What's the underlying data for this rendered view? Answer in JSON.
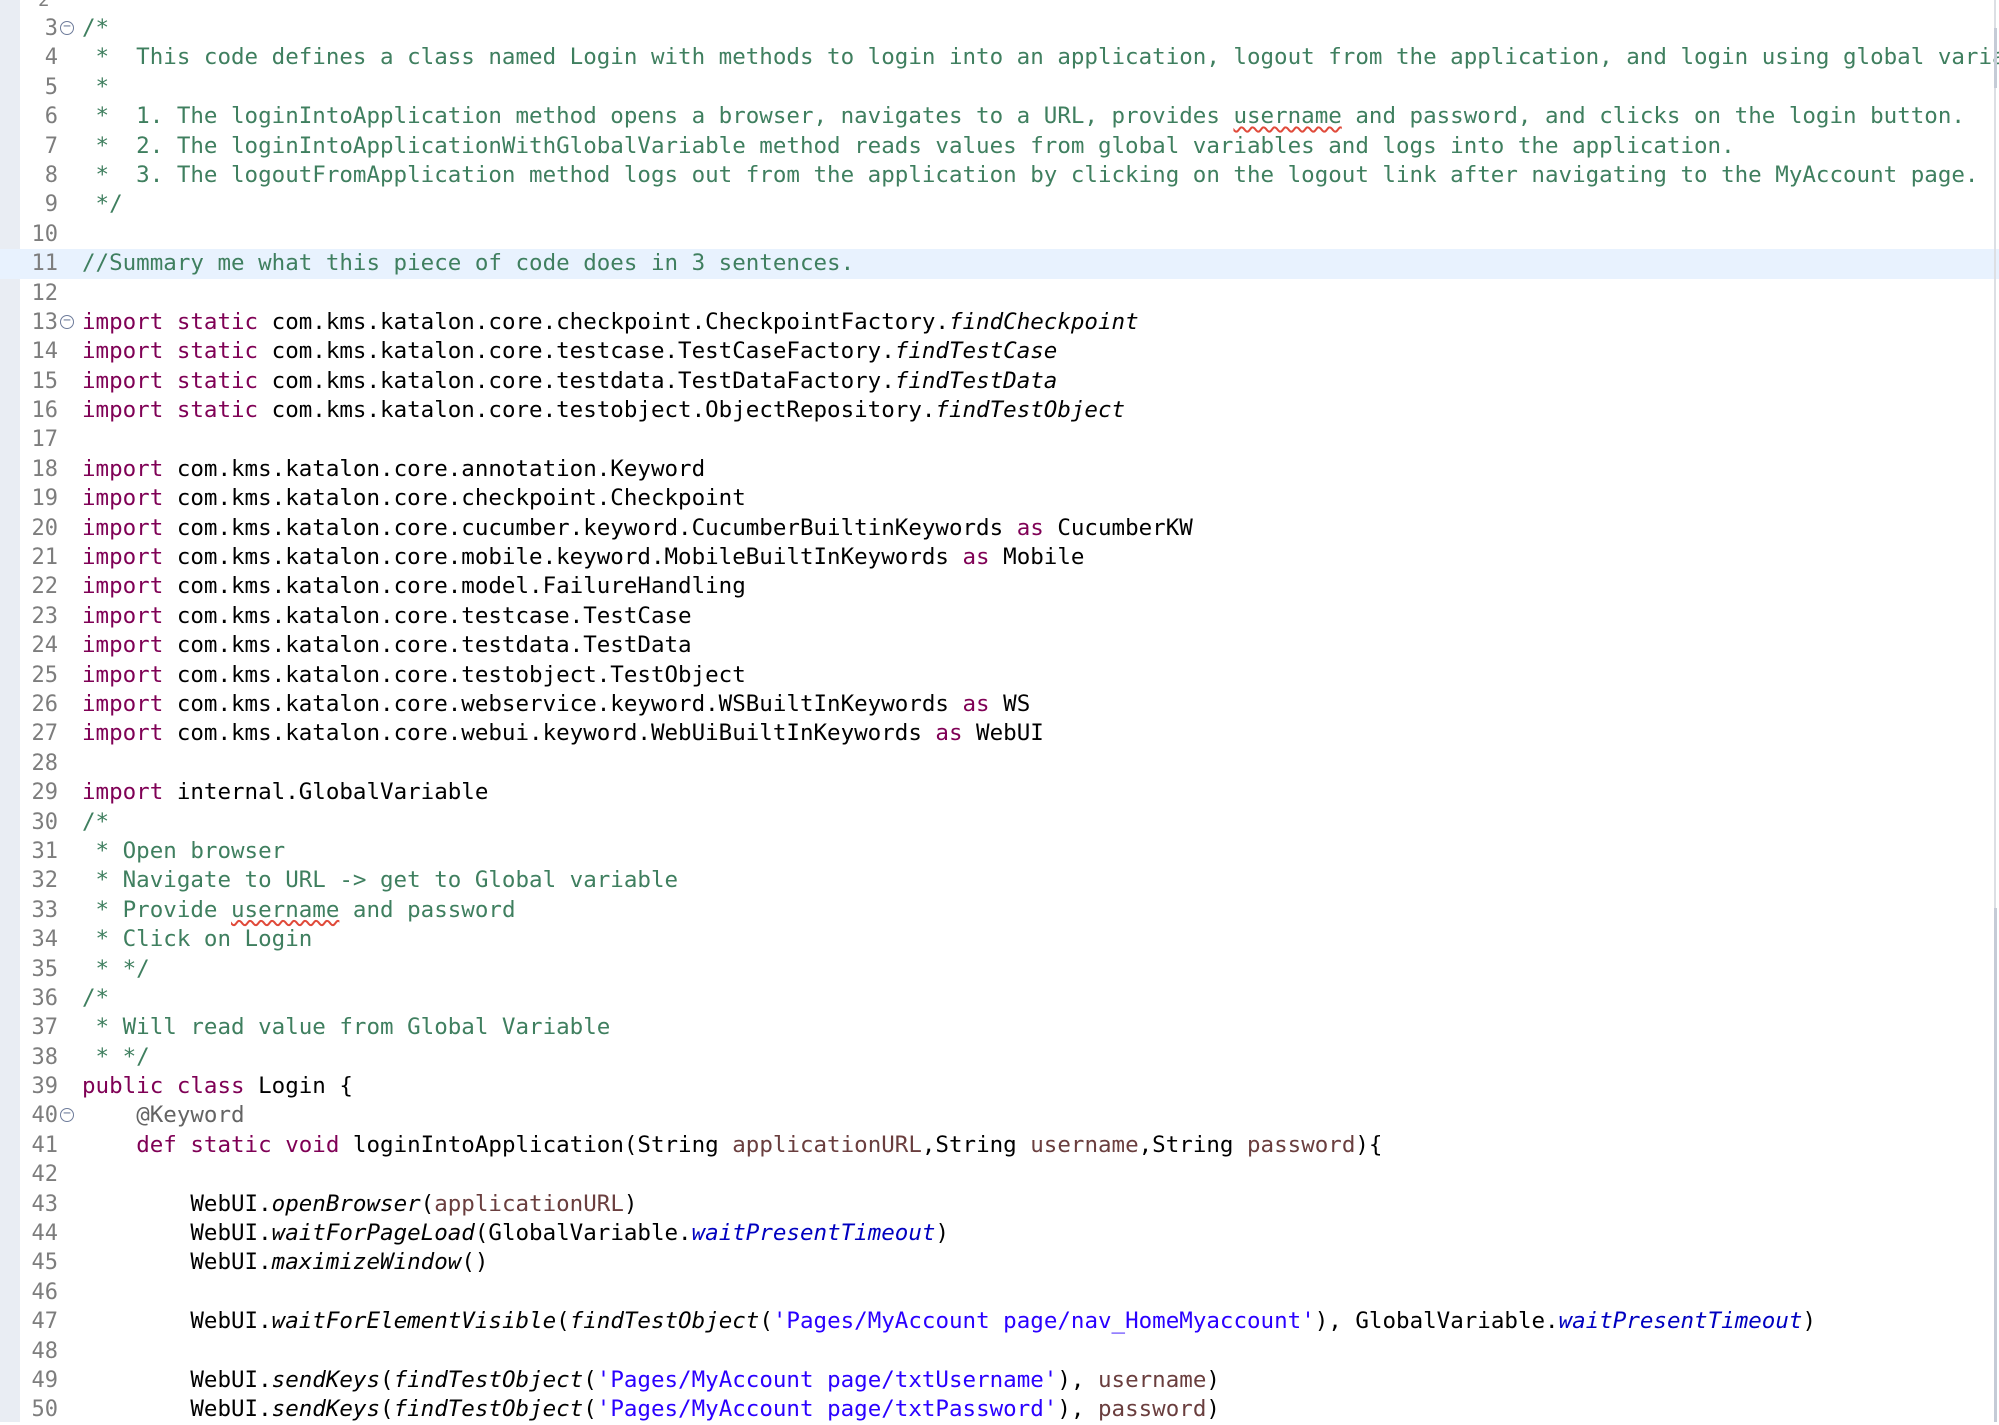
{
  "editor": {
    "top_line_number": "2",
    "lines": [
      {
        "n": "3",
        "fold": true,
        "highlight": false,
        "segs": [
          {
            "t": "/*",
            "c": "comment"
          }
        ]
      },
      {
        "n": "4",
        "fold": false,
        "highlight": false,
        "segs": [
          {
            "t": " *  This code defines a class named Login with methods to login into an application, logout from the application, and login using global variables.",
            "c": "comment"
          }
        ]
      },
      {
        "n": "5",
        "fold": false,
        "highlight": false,
        "segs": [
          {
            "t": " *",
            "c": "comment"
          }
        ]
      },
      {
        "n": "6",
        "fold": false,
        "highlight": false,
        "segs": [
          {
            "t": " *  1. The loginIntoApplication method opens a browser, navigates to a URL, provides ",
            "c": "comment"
          },
          {
            "t": "username",
            "c": "comment",
            "spell": true
          },
          {
            "t": " and password, and clicks on the login button.",
            "c": "comment"
          }
        ]
      },
      {
        "n": "7",
        "fold": false,
        "highlight": false,
        "segs": [
          {
            "t": " *  2. The loginIntoApplicationWithGlobalVariable method reads values from global variables and logs into the application.",
            "c": "comment"
          }
        ]
      },
      {
        "n": "8",
        "fold": false,
        "highlight": false,
        "segs": [
          {
            "t": " *  3. The logoutFromApplication method logs out from the application by clicking on the logout link after navigating to the MyAccount page.",
            "c": "comment"
          }
        ]
      },
      {
        "n": "9",
        "fold": false,
        "highlight": false,
        "segs": [
          {
            "t": " */",
            "c": "comment"
          }
        ]
      },
      {
        "n": "10",
        "fold": false,
        "highlight": false,
        "segs": []
      },
      {
        "n": "11",
        "fold": false,
        "highlight": true,
        "segs": [
          {
            "t": "//Summary me what this piece of code does in 3 sentences.",
            "c": "comment"
          }
        ]
      },
      {
        "n": "12",
        "fold": false,
        "highlight": false,
        "segs": []
      },
      {
        "n": "13",
        "fold": true,
        "highlight": false,
        "segs": [
          {
            "t": "import static",
            "c": "keyword"
          },
          {
            "t": " com.kms.katalon.core.checkpoint.CheckpointFactory.",
            "c": "plain"
          },
          {
            "t": "findCheckpoint",
            "c": "method"
          }
        ]
      },
      {
        "n": "14",
        "fold": false,
        "highlight": false,
        "segs": [
          {
            "t": "import static",
            "c": "keyword"
          },
          {
            "t": " com.kms.katalon.core.testcase.TestCaseFactory.",
            "c": "plain"
          },
          {
            "t": "findTestCase",
            "c": "method"
          }
        ]
      },
      {
        "n": "15",
        "fold": false,
        "highlight": false,
        "segs": [
          {
            "t": "import static",
            "c": "keyword"
          },
          {
            "t": " com.kms.katalon.core.testdata.TestDataFactory.",
            "c": "plain"
          },
          {
            "t": "findTestData",
            "c": "method"
          }
        ]
      },
      {
        "n": "16",
        "fold": false,
        "highlight": false,
        "segs": [
          {
            "t": "import static",
            "c": "keyword"
          },
          {
            "t": " com.kms.katalon.core.testobject.ObjectRepository.",
            "c": "plain"
          },
          {
            "t": "findTestObject",
            "c": "method"
          }
        ]
      },
      {
        "n": "17",
        "fold": false,
        "highlight": false,
        "segs": []
      },
      {
        "n": "18",
        "fold": false,
        "highlight": false,
        "segs": [
          {
            "t": "import",
            "c": "keyword"
          },
          {
            "t": " com.kms.katalon.core.annotation.Keyword",
            "c": "plain"
          }
        ]
      },
      {
        "n": "19",
        "fold": false,
        "highlight": false,
        "segs": [
          {
            "t": "import",
            "c": "keyword"
          },
          {
            "t": " com.kms.katalon.core.checkpoint.Checkpoint",
            "c": "plain"
          }
        ]
      },
      {
        "n": "20",
        "fold": false,
        "highlight": false,
        "segs": [
          {
            "t": "import",
            "c": "keyword"
          },
          {
            "t": " com.kms.katalon.core.cucumber.keyword.CucumberBuiltinKeywords ",
            "c": "plain"
          },
          {
            "t": "as",
            "c": "keyword"
          },
          {
            "t": " CucumberKW",
            "c": "plain"
          }
        ]
      },
      {
        "n": "21",
        "fold": false,
        "highlight": false,
        "segs": [
          {
            "t": "import",
            "c": "keyword"
          },
          {
            "t": " com.kms.katalon.core.mobile.keyword.MobileBuiltInKeywords ",
            "c": "plain"
          },
          {
            "t": "as",
            "c": "keyword"
          },
          {
            "t": " Mobile",
            "c": "plain"
          }
        ]
      },
      {
        "n": "22",
        "fold": false,
        "highlight": false,
        "segs": [
          {
            "t": "import",
            "c": "keyword"
          },
          {
            "t": " com.kms.katalon.core.model.FailureHandling",
            "c": "plain"
          }
        ]
      },
      {
        "n": "23",
        "fold": false,
        "highlight": false,
        "segs": [
          {
            "t": "import",
            "c": "keyword"
          },
          {
            "t": " com.kms.katalon.core.testcase.TestCase",
            "c": "plain"
          }
        ]
      },
      {
        "n": "24",
        "fold": false,
        "highlight": false,
        "segs": [
          {
            "t": "import",
            "c": "keyword"
          },
          {
            "t": " com.kms.katalon.core.testdata.TestData",
            "c": "plain"
          }
        ]
      },
      {
        "n": "25",
        "fold": false,
        "highlight": false,
        "segs": [
          {
            "t": "import",
            "c": "keyword"
          },
          {
            "t": " com.kms.katalon.core.testobject.TestObject",
            "c": "plain"
          }
        ]
      },
      {
        "n": "26",
        "fold": false,
        "highlight": false,
        "segs": [
          {
            "t": "import",
            "c": "keyword"
          },
          {
            "t": " com.kms.katalon.core.webservice.keyword.WSBuiltInKeywords ",
            "c": "plain"
          },
          {
            "t": "as",
            "c": "keyword"
          },
          {
            "t": " WS",
            "c": "plain"
          }
        ]
      },
      {
        "n": "27",
        "fold": false,
        "highlight": false,
        "segs": [
          {
            "t": "import",
            "c": "keyword"
          },
          {
            "t": " com.kms.katalon.core.webui.keyword.WebUiBuiltInKeywords ",
            "c": "plain"
          },
          {
            "t": "as",
            "c": "keyword"
          },
          {
            "t": " WebUI",
            "c": "plain"
          }
        ]
      },
      {
        "n": "28",
        "fold": false,
        "highlight": false,
        "segs": []
      },
      {
        "n": "29",
        "fold": false,
        "highlight": false,
        "segs": [
          {
            "t": "import",
            "c": "keyword"
          },
          {
            "t": " internal.GlobalVariable",
            "c": "plain"
          }
        ]
      },
      {
        "n": "30",
        "fold": false,
        "highlight": false,
        "segs": [
          {
            "t": "/*",
            "c": "comment"
          }
        ]
      },
      {
        "n": "31",
        "fold": false,
        "highlight": false,
        "segs": [
          {
            "t": " * Open browser",
            "c": "comment"
          }
        ]
      },
      {
        "n": "32",
        "fold": false,
        "highlight": false,
        "segs": [
          {
            "t": " * Navigate to URL -> get to Global variable",
            "c": "comment"
          }
        ]
      },
      {
        "n": "33",
        "fold": false,
        "highlight": false,
        "segs": [
          {
            "t": " * Provide ",
            "c": "comment"
          },
          {
            "t": "username",
            "c": "comment",
            "spell": true
          },
          {
            "t": " and password",
            "c": "comment"
          }
        ]
      },
      {
        "n": "34",
        "fold": false,
        "highlight": false,
        "segs": [
          {
            "t": " * Click on Login",
            "c": "comment"
          }
        ]
      },
      {
        "n": "35",
        "fold": false,
        "highlight": false,
        "segs": [
          {
            "t": " * */",
            "c": "comment"
          }
        ]
      },
      {
        "n": "36",
        "fold": false,
        "highlight": false,
        "segs": [
          {
            "t": "/*",
            "c": "comment"
          }
        ]
      },
      {
        "n": "37",
        "fold": false,
        "highlight": false,
        "segs": [
          {
            "t": " * Will read value from Global Variable",
            "c": "comment"
          }
        ]
      },
      {
        "n": "38",
        "fold": false,
        "highlight": false,
        "segs": [
          {
            "t": " * */",
            "c": "comment"
          }
        ]
      },
      {
        "n": "39",
        "fold": false,
        "highlight": false,
        "segs": [
          {
            "t": "public class",
            "c": "keyword"
          },
          {
            "t": " Login {",
            "c": "plain"
          }
        ]
      },
      {
        "n": "40",
        "fold": true,
        "highlight": false,
        "segs": [
          {
            "t": "    ",
            "c": "plain"
          },
          {
            "t": "@Keyword",
            "c": "annotation"
          }
        ]
      },
      {
        "n": "41",
        "fold": false,
        "highlight": false,
        "segs": [
          {
            "t": "    ",
            "c": "plain"
          },
          {
            "t": "def static void",
            "c": "keyword"
          },
          {
            "t": " loginIntoApplication(String ",
            "c": "plain"
          },
          {
            "t": "applicationURL",
            "c": "param"
          },
          {
            "t": ",String ",
            "c": "plain"
          },
          {
            "t": "username",
            "c": "param"
          },
          {
            "t": ",String ",
            "c": "plain"
          },
          {
            "t": "password",
            "c": "param"
          },
          {
            "t": "){",
            "c": "plain"
          }
        ]
      },
      {
        "n": "42",
        "fold": false,
        "highlight": false,
        "segs": []
      },
      {
        "n": "43",
        "fold": false,
        "highlight": false,
        "segs": [
          {
            "t": "        WebUI.",
            "c": "plain"
          },
          {
            "t": "openBrowser",
            "c": "method"
          },
          {
            "t": "(",
            "c": "plain"
          },
          {
            "t": "applicationURL",
            "c": "param"
          },
          {
            "t": ")",
            "c": "plain"
          }
        ]
      },
      {
        "n": "44",
        "fold": false,
        "highlight": false,
        "segs": [
          {
            "t": "        WebUI.",
            "c": "plain"
          },
          {
            "t": "waitForPageLoad",
            "c": "method"
          },
          {
            "t": "(GlobalVariable.",
            "c": "plain"
          },
          {
            "t": "waitPresentTimeout",
            "c": "field"
          },
          {
            "t": ")",
            "c": "plain"
          }
        ]
      },
      {
        "n": "45",
        "fold": false,
        "highlight": false,
        "segs": [
          {
            "t": "        WebUI.",
            "c": "plain"
          },
          {
            "t": "maximizeWindow",
            "c": "method"
          },
          {
            "t": "()",
            "c": "plain"
          }
        ]
      },
      {
        "n": "46",
        "fold": false,
        "highlight": false,
        "segs": []
      },
      {
        "n": "47",
        "fold": false,
        "highlight": false,
        "segs": [
          {
            "t": "        WebUI.",
            "c": "plain"
          },
          {
            "t": "waitForElementVisible",
            "c": "method"
          },
          {
            "t": "(",
            "c": "plain"
          },
          {
            "t": "findTestObject",
            "c": "method"
          },
          {
            "t": "(",
            "c": "plain"
          },
          {
            "t": "'Pages/MyAccount page/nav_HomeMyaccount'",
            "c": "string"
          },
          {
            "t": "), GlobalVariable.",
            "c": "plain"
          },
          {
            "t": "waitPresentTimeout",
            "c": "field"
          },
          {
            "t": ")",
            "c": "plain"
          }
        ]
      },
      {
        "n": "48",
        "fold": false,
        "highlight": false,
        "segs": []
      },
      {
        "n": "49",
        "fold": false,
        "highlight": false,
        "segs": [
          {
            "t": "        WebUI.",
            "c": "plain"
          },
          {
            "t": "sendKeys",
            "c": "method"
          },
          {
            "t": "(",
            "c": "plain"
          },
          {
            "t": "findTestObject",
            "c": "method"
          },
          {
            "t": "(",
            "c": "plain"
          },
          {
            "t": "'Pages/MyAccount page/txtUsername'",
            "c": "string"
          },
          {
            "t": "), ",
            "c": "plain"
          },
          {
            "t": "username",
            "c": "param"
          },
          {
            "t": ")",
            "c": "plain"
          }
        ]
      },
      {
        "n": "50",
        "fold": false,
        "highlight": false,
        "segs": [
          {
            "t": "        WebUI.",
            "c": "plain"
          },
          {
            "t": "sendKeys",
            "c": "method"
          },
          {
            "t": "(",
            "c": "plain"
          },
          {
            "t": "findTestObject",
            "c": "method"
          },
          {
            "t": "(",
            "c": "plain"
          },
          {
            "t": "'Pages/MyAccount page/txtPassword'",
            "c": "string"
          },
          {
            "t": "), ",
            "c": "plain"
          },
          {
            "t": "password",
            "c": "param"
          },
          {
            "t": ")",
            "c": "plain"
          }
        ]
      }
    ]
  },
  "colors": {
    "comment": "#3f7f5f",
    "keyword": "#7f0055",
    "string": "#2a00ff",
    "field": "#0000c0",
    "param": "#6a3e3e",
    "annotation": "#646464",
    "line_number": "#7d7d7d",
    "current_line_highlight": "#e8f2fe",
    "spelling_underline": "#e04a3a"
  },
  "icons": {
    "fold": "collapse-fold-icon"
  }
}
